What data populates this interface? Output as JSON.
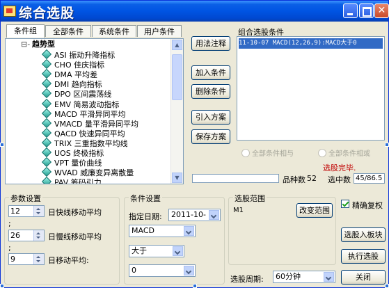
{
  "window": {
    "title": "综合选股"
  },
  "tabs": [
    "条件组",
    "全部条件",
    "系统条件",
    "用户条件"
  ],
  "tree": {
    "root": "趋势型",
    "items": [
      "ASI 振动升降指标",
      "CHO 佳庆指标",
      "DMA 平均差",
      "DMI 趋向指标",
      "DPO 区间震荡线",
      "EMV 简易波动指标",
      "MACD 平滑异同平均",
      "VMACD 量平滑异同平均",
      "QACD 快速异同平均",
      "TRIX 三重指数平均线",
      "UOS 终极指标",
      "VPT 量价曲线",
      "WVAD 威廉变异离散量",
      "PAV 筹码引力"
    ]
  },
  "buttons": {
    "usage": "用法注释",
    "add": "加入条件",
    "delete": "删除条件",
    "load": "引入方案",
    "save": "保存方案",
    "change_range": "改变范围",
    "to_sector": "选股入板块",
    "execute": "执行选股",
    "close": "关闭"
  },
  "combo": {
    "label": "组合选股条件",
    "items": [
      "11-10-07 MACD(12,26,9):MACD大于0"
    ]
  },
  "logic": {
    "and": "全部条件相与",
    "or": "全部条件相或"
  },
  "status": {
    "done": "选股完毕.",
    "count_label": "品种数",
    "count_value": "52",
    "selected_label": "选中数",
    "selected_value": "45/86.5"
  },
  "params": {
    "label": "参数设置",
    "rows": [
      {
        "value": "12",
        "label": "日快线移动平均"
      },
      {
        "value": "26",
        "label": "日慢线移动平均"
      },
      {
        "value": "9",
        "label": "日移动平均:"
      }
    ],
    "separator": ";"
  },
  "condition": {
    "label": "条件设置",
    "date_label": "指定日期:",
    "date_value": "2011-10- 7",
    "indicator": "MACD",
    "operator": "大于",
    "value": "0"
  },
  "range": {
    "label": "选股范围",
    "value": "M1",
    "precise_label": "精确复权",
    "precise_checked": true,
    "period_label": "选股周期:",
    "period_value": "60分钟"
  }
}
